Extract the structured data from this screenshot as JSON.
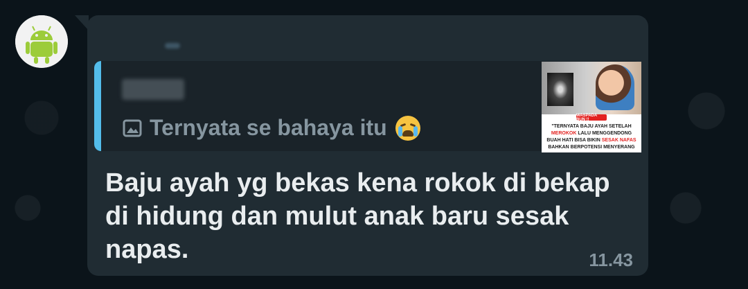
{
  "quoted": {
    "text": "Ternyata se bahaya itu",
    "thumbnail": {
      "banner": "WASPADA BUN !!",
      "line1": "\"TERNYATA BAJU AYAH SETELAH",
      "line2_highlight": "MEROKOK",
      "line2_rest": " LALU MENGGENDONG",
      "line3_start": "BUAH HATI BISA BIKIN ",
      "line3_highlight": "SESAK NAFAS",
      "line4": "BAHKAN BERPOTENSI MENYERANG"
    }
  },
  "message": {
    "text": "Baju ayah yg bekas kena rokok di bekap di hidung dan mulut anak baru sesak napas.",
    "time": "11.43"
  },
  "icons": {
    "avatar": "android-avatar-icon",
    "quote_media": "image-icon",
    "emoji": "loudly-crying-face-emoji"
  },
  "colors": {
    "background": "#0b141a",
    "bubble": "#202c33",
    "quote_bar": "#53bdeb",
    "text": "#e9edef",
    "muted": "#8696a0"
  }
}
